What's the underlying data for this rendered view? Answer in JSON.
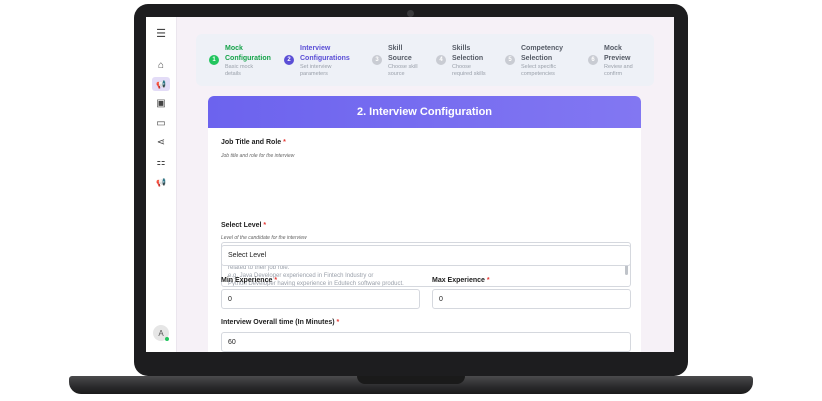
{
  "sidebar": {
    "menu_icon": "☰",
    "items": [
      {
        "icon": "home-icon",
        "glyph": "⌂"
      },
      {
        "icon": "megaphone-icon",
        "glyph": "📢"
      },
      {
        "icon": "id-card-icon",
        "glyph": "▣"
      },
      {
        "icon": "monitor-icon",
        "glyph": "▭"
      },
      {
        "icon": "share-icon",
        "glyph": "⋖"
      },
      {
        "icon": "grid-icon",
        "glyph": "⚏"
      },
      {
        "icon": "megaphone-icon",
        "glyph": "📢"
      }
    ],
    "avatar_letter": "A"
  },
  "stepper": {
    "steps": [
      {
        "num": "1",
        "title": "Mock\nConfiguration",
        "desc": "Basic mock\ndetails",
        "state": "done"
      },
      {
        "num": "2",
        "title": "Interview\nConfigurations",
        "desc": "Set interview\nparameters",
        "state": "active"
      },
      {
        "num": "3",
        "title": "Skill\nSource",
        "desc": "Choose skill\nsource",
        "state": "pending"
      },
      {
        "num": "4",
        "title": "Skills\nSelection",
        "desc": "Choose\nrequired skills",
        "state": "pending"
      },
      {
        "num": "5",
        "title": "Competency\nSelection",
        "desc": "Select specific\ncompetencies",
        "state": "pending"
      },
      {
        "num": "6",
        "title": "Mock\nPreview",
        "desc": "Review and\nconfirm",
        "state": "pending"
      }
    ]
  },
  "form": {
    "header": "2. Interview Configuration",
    "job_title": {
      "label": "Job Title and Role",
      "hint": "Job title and role for the interview",
      "placeholder": "Enter Job Title with brief of Industry or Domain expertise required. This field is important for our AI engine to ask right questions\nrelated to their job role.\ne.g. Java Developer experienced in Fintech Industry or\nPython Developer having experience in Edutech software product."
    },
    "level": {
      "label": "Select Level",
      "hint": "Level of the candidate for the interview",
      "value": "Select Level"
    },
    "min_exp": {
      "label": "Min Experience",
      "value": "0"
    },
    "max_exp": {
      "label": "Max Experience",
      "value": "0"
    },
    "duration": {
      "label": "Interview Overall time (In Minutes)",
      "value": "60"
    },
    "required_mark": "*"
  },
  "colors": {
    "done": "#22c55e",
    "active": "#5b4fd6",
    "pending": "#c9ccd3",
    "done_text": "#16a34a",
    "active_text": "#5b4fd6",
    "pending_text": "#555b66"
  }
}
